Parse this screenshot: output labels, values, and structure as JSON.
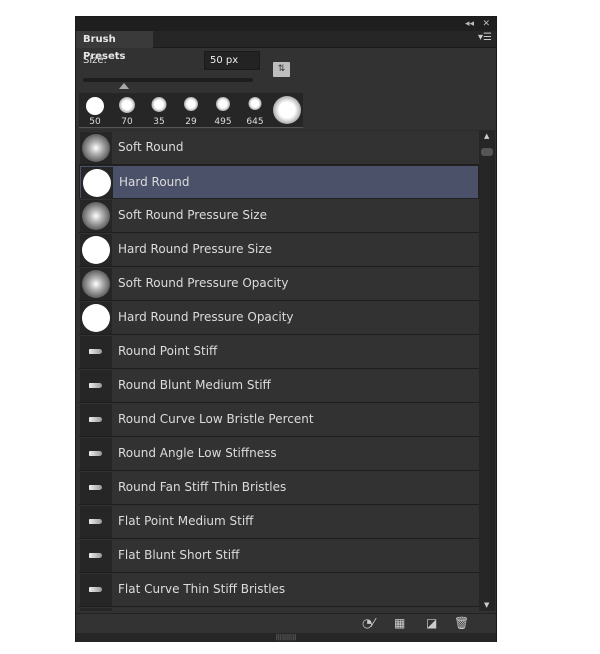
{
  "panel": {
    "title": "Brush Presets",
    "collapse_icon": "double-chevron-left-icon",
    "close_icon": "close-icon",
    "menu_icon": "panel-menu-icon"
  },
  "size": {
    "label": "Size:",
    "value": "50 px"
  },
  "recent_tips": [
    {
      "label": "50",
      "type": "hard"
    },
    {
      "label": "70",
      "type": "soft"
    },
    {
      "label": "35",
      "type": "soft"
    },
    {
      "label": "29",
      "type": "soft"
    },
    {
      "label": "495",
      "type": "soft"
    },
    {
      "label": "645",
      "type": "soft"
    },
    {
      "label": "",
      "type": "soft"
    }
  ],
  "presets": [
    {
      "name": "Soft Round",
      "thumb": "soft"
    },
    {
      "name": "Hard Round",
      "thumb": "hard",
      "selected": true
    },
    {
      "name": "Soft Round Pressure Size",
      "thumb": "soft"
    },
    {
      "name": "Hard Round Pressure Size",
      "thumb": "hard"
    },
    {
      "name": "Soft Round Pressure Opacity",
      "thumb": "soft"
    },
    {
      "name": "Hard Round Pressure Opacity",
      "thumb": "hard"
    },
    {
      "name": "Round Point Stiff",
      "thumb": "bristle"
    },
    {
      "name": "Round Blunt Medium Stiff",
      "thumb": "bristle"
    },
    {
      "name": "Round Curve Low Bristle Percent",
      "thumb": "bristle"
    },
    {
      "name": "Round Angle Low Stiffness",
      "thumb": "bristle"
    },
    {
      "name": "Round Fan Stiff Thin Bristles",
      "thumb": "bristle"
    },
    {
      "name": "Flat Point Medium Stiff",
      "thumb": "bristle"
    },
    {
      "name": "Flat Blunt Short Stiff",
      "thumb": "bristle"
    },
    {
      "name": "Flat Curve Thin Stiff Bristles",
      "thumb": "bristle"
    },
    {
      "name": "",
      "thumb": "bristle"
    }
  ],
  "footer_icons": [
    "toggle-brush-preview-icon",
    "brush-panel-icon",
    "new-preset-icon",
    "trash-icon"
  ]
}
